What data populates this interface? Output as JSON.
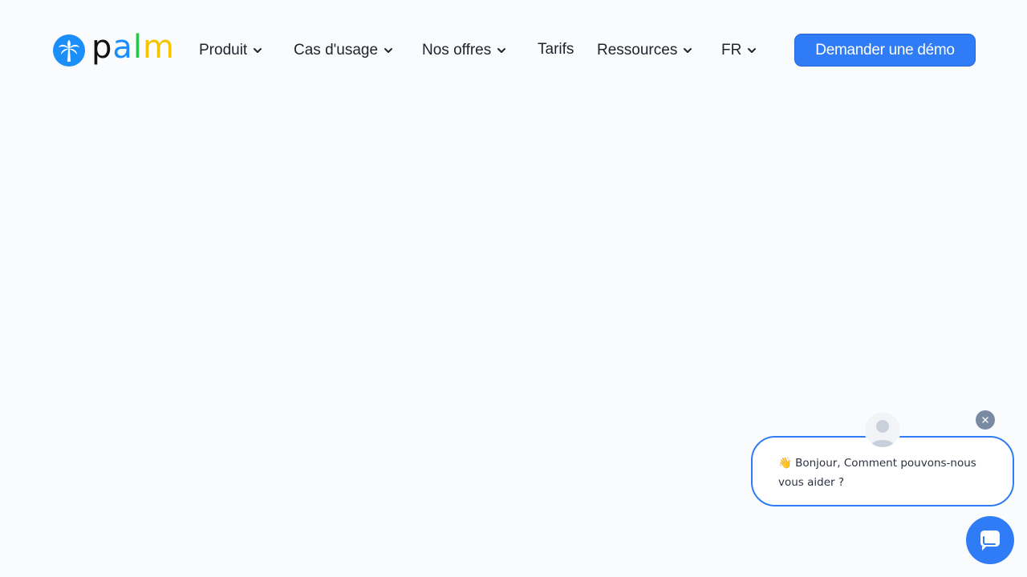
{
  "brand": {
    "name_parts": [
      "p",
      "a",
      "l",
      "m"
    ],
    "colors": [
      "#111111",
      "#1c8ef9",
      "#2ac44e",
      "#f5c400"
    ],
    "icon": "palm-tree-icon"
  },
  "nav": {
    "items": [
      {
        "label": "Produit",
        "has_dropdown": true
      },
      {
        "label": "Cas d'usage",
        "has_dropdown": true
      },
      {
        "label": "Nos offres",
        "has_dropdown": true
      },
      {
        "label": "Tarifs",
        "has_dropdown": false
      },
      {
        "label": "Ressources",
        "has_dropdown": true
      },
      {
        "label": "FR",
        "has_dropdown": true
      }
    ],
    "cta_label": "Demander une démo"
  },
  "chat": {
    "greeting_emoji": "👋",
    "message": "Bonjour, Comment pouvons-nous vous aider ?",
    "accent_color": "#2f7cf6"
  }
}
